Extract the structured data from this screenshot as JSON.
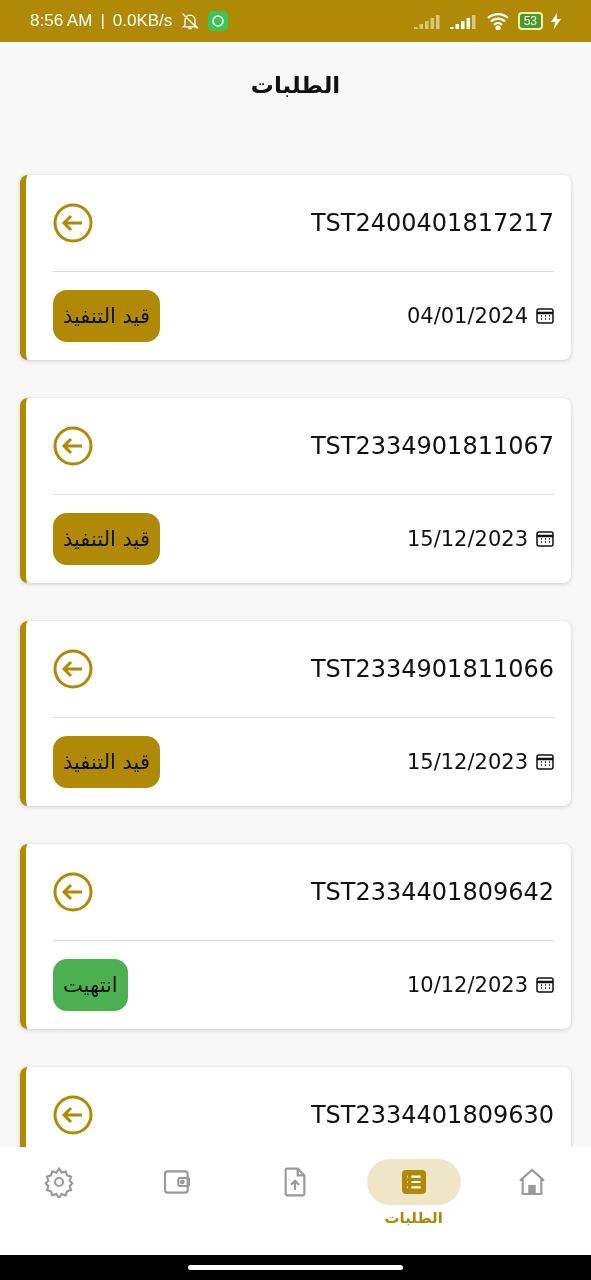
{
  "status_bar": {
    "time": "8:56 AM",
    "separator": "|",
    "speed": "0.0KB/s",
    "battery": "53"
  },
  "header": {
    "title": "الطلبات"
  },
  "orders": [
    {
      "id": "TST2400401817217",
      "date": "04/01/2024",
      "status": {
        "label": "قيد التنفيذ",
        "kind": "in_progress"
      }
    },
    {
      "id": "TST2334901811067",
      "date": "15/12/2023",
      "status": {
        "label": "قيد التنفيذ",
        "kind": "in_progress"
      }
    },
    {
      "id": "TST2334901811066",
      "date": "15/12/2023",
      "status": {
        "label": "قيد التنفيذ",
        "kind": "in_progress"
      }
    },
    {
      "id": "TST2334401809642",
      "date": "10/12/2023",
      "status": {
        "label": "انتهيت",
        "kind": "done"
      }
    },
    {
      "id": "TST2334401809630"
    }
  ],
  "nav": [
    {
      "kind": "home",
      "selected": false
    },
    {
      "kind": "orders",
      "selected": true,
      "label": "الطلبات"
    },
    {
      "kind": "upload",
      "selected": false
    },
    {
      "kind": "wallet",
      "selected": false
    },
    {
      "kind": "settings",
      "selected": false
    }
  ]
}
